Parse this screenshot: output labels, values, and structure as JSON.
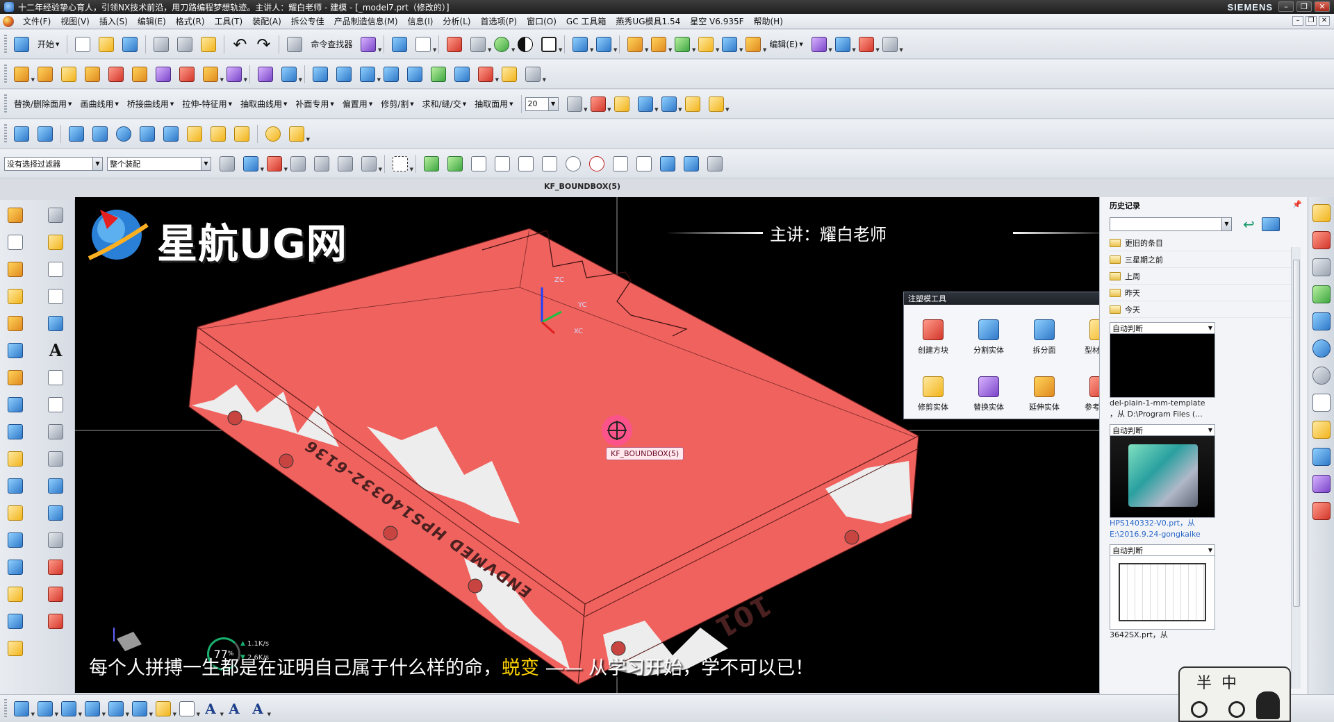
{
  "window": {
    "title": "十二年经验挚心育人，引领NX技术前沿，用刀路编程梦想轨迹。主讲人：耀白老师 - 建模 - [_model7.prt（修改的）]",
    "brand": "SIEMENS",
    "buttons": {
      "minimize": "–",
      "restore": "❐",
      "close": "✕"
    }
  },
  "menubar": {
    "items": [
      "文件(F)",
      "视图(V)",
      "插入(S)",
      "编辑(E)",
      "格式(R)",
      "工具(T)",
      "装配(A)",
      "拆公专佳",
      "产品制造信息(M)",
      "信息(I)",
      "分析(L)",
      "首选项(P)",
      "窗口(O)",
      "GC 工具箱",
      "燕秀UG模具1.54",
      "星空 V6.935F",
      "帮助(H)"
    ]
  },
  "toolbar1": {
    "start_label": "开始",
    "command_finder_label": "命令查找器",
    "edit_label": "编辑(E)"
  },
  "toolbar3": {
    "labels": [
      "替换/删除面用",
      "画曲线用",
      "桥接曲线用",
      "拉伸-特征用",
      "抽取曲线用",
      "补面专用",
      "偏置用",
      "修剪/割",
      "求和/缝/交",
      "抽取面用"
    ],
    "number_value": "20"
  },
  "selection_bar": {
    "filter_value": "没有选择过滤器",
    "scope_value": "整个装配"
  },
  "viewport": {
    "title": "KF_BOUNDBOX(5)",
    "snap_label": "KF_BOUNDBOX(5)",
    "logo_text": "星航UG网",
    "lecturer": "主讲：耀白老师",
    "subtitle_part1": "每个人拼搏一生都是在证明自己属于什么样的命，",
    "subtitle_highlight": "蜕变",
    "subtitle_part2": " —— 从学习开始，学不可以已！",
    "axis_zc": "ZC",
    "axis_yc": "YC",
    "axis_xc": "XC",
    "model_text_side": "ENDVMED HPS140332-6136",
    "model_text_front": "101",
    "net_percent": "77",
    "net_up": "1.1K/s",
    "net_down": "2.6K/s"
  },
  "dialog": {
    "title": "注塑模工具",
    "tools": [
      "创建方块",
      "分割实体",
      "拆分面",
      "型材尺寸",
      "修剪实体",
      "替换实体",
      "延伸实体",
      "参考圆角"
    ]
  },
  "history": {
    "title": "历史记录",
    "groups": [
      "更旧的条目",
      "三星期之前",
      "上周",
      "昨天",
      "今天"
    ],
    "cards": [
      {
        "caption": "自动判断",
        "file": "del-plain-1-mm-template",
        "path": "，从 D:\\Program Files (..."
      },
      {
        "caption": "自动判断",
        "file": "HPS140332-V0.prt，从",
        "path": "E:\\2016.9.24-gongkaike"
      },
      {
        "caption": "自动判断",
        "file": "3642SX.prt，从"
      }
    ]
  },
  "badge": {
    "text": "半中"
  },
  "colors": {
    "model_face": "#f0625e",
    "viewport_bg": "#000000",
    "subtitle_highlight": "#ffd200"
  }
}
